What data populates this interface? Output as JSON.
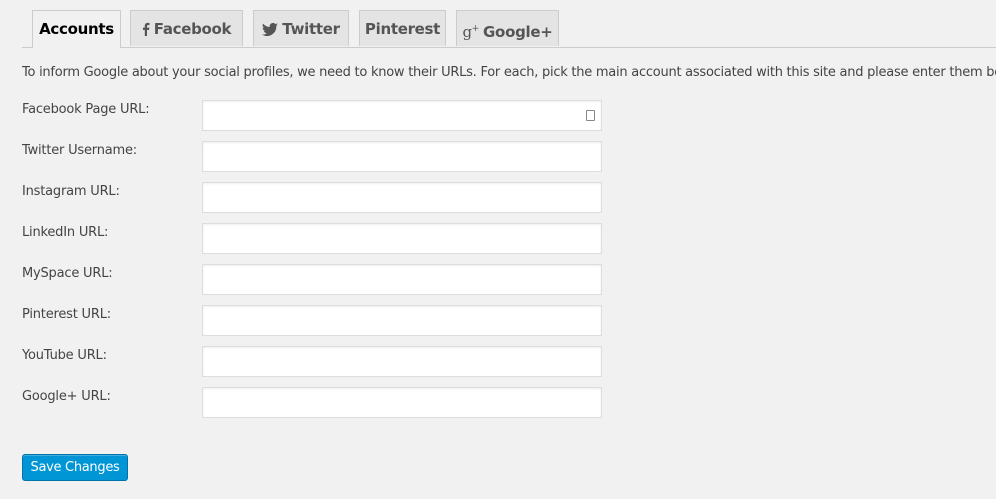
{
  "tabs": [
    {
      "label": "Accounts",
      "icon": ""
    },
    {
      "label": "Facebook",
      "icon": "facebook-icon"
    },
    {
      "label": "Twitter",
      "icon": "twitter-icon"
    },
    {
      "label": "Pinterest",
      "icon": ""
    },
    {
      "label": "Google+",
      "icon": "google-plus-icon"
    }
  ],
  "intro": "To inform Google about your social profiles, we need to know their URLs. For each, pick the main account associated with this site and please enter them below:",
  "fields": [
    {
      "label": "Facebook Page URL:",
      "value": ""
    },
    {
      "label": "Twitter Username:",
      "value": ""
    },
    {
      "label": "Instagram URL:",
      "value": ""
    },
    {
      "label": "LinkedIn URL:",
      "value": ""
    },
    {
      "label": "MySpace URL:",
      "value": ""
    },
    {
      "label": "Pinterest URL:",
      "value": ""
    },
    {
      "label": "YouTube URL:",
      "value": ""
    },
    {
      "label": "Google+ URL:",
      "value": ""
    }
  ],
  "save_label": "Save Changes",
  "colors": {
    "primary": "#0096d6"
  }
}
